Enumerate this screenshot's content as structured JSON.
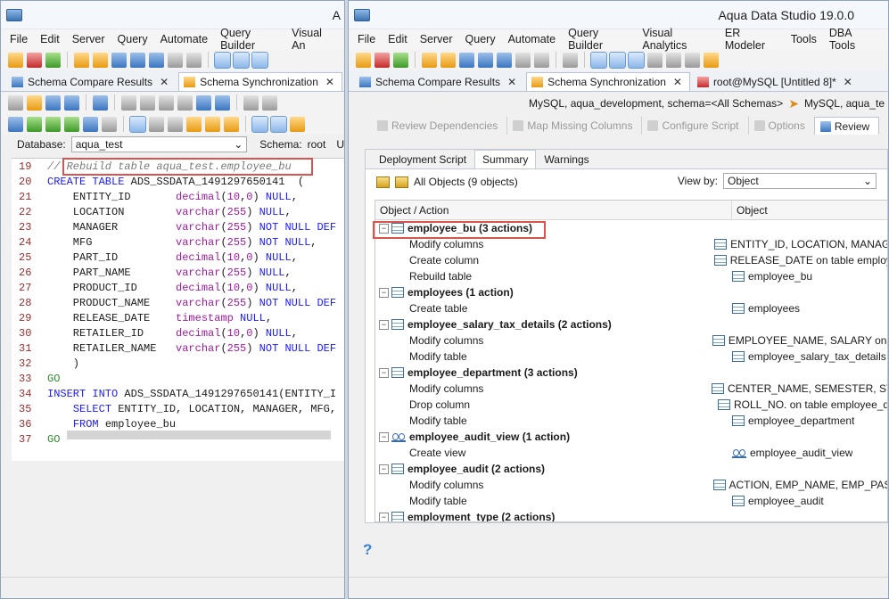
{
  "left": {
    "menu": [
      "File",
      "Edit",
      "Server",
      "Query",
      "Automate",
      "Query Builder",
      "Visual An"
    ],
    "title_fragment": "A",
    "tabs": [
      {
        "label": "Schema Compare Results"
      },
      {
        "label": "Schema Synchronization"
      }
    ],
    "database_label": "Database:",
    "database_value": "aqua_test",
    "schema_label": "Schema:",
    "schema_value": "root",
    "schema_extra": "U",
    "code_lines": [
      {
        "n": "19",
        "text": "// Rebuild table aqua_test.employee_bu",
        "kind": "comment"
      },
      {
        "n": "20",
        "text": "CREATE TABLE ADS_SSDATA_1491297650141  (",
        "kind": "create"
      },
      {
        "n": "21",
        "text": "    ENTITY_ID       decimal(10,0) NULL,",
        "kind": "col"
      },
      {
        "n": "22",
        "text": "    LOCATION        varchar(255) NULL,",
        "kind": "col"
      },
      {
        "n": "23",
        "text": "    MANAGER         varchar(255) NOT NULL DEF",
        "kind": "col"
      },
      {
        "n": "24",
        "text": "    MFG             varchar(255) NOT NULL,",
        "kind": "col"
      },
      {
        "n": "25",
        "text": "    PART_ID         decimal(10,0) NULL,",
        "kind": "col"
      },
      {
        "n": "26",
        "text": "    PART_NAME       varchar(255) NULL,",
        "kind": "col"
      },
      {
        "n": "27",
        "text": "    PRODUCT_ID      decimal(10,0) NULL,",
        "kind": "col"
      },
      {
        "n": "28",
        "text": "    PRODUCT_NAME    varchar(255) NOT NULL DEF",
        "kind": "col"
      },
      {
        "n": "29",
        "text": "    RELEASE_DATE    timestamp NULL,",
        "kind": "col"
      },
      {
        "n": "30",
        "text": "    RETAILER_ID     decimal(10,0) NULL,",
        "kind": "col"
      },
      {
        "n": "31",
        "text": "    RETAILER_NAME   varchar(255) NOT NULL DEF",
        "kind": "col"
      },
      {
        "n": "32",
        "text": "    )",
        "kind": "plain"
      },
      {
        "n": "33",
        "text": "GO",
        "kind": "go"
      },
      {
        "n": "34",
        "text": "INSERT INTO ADS_SSDATA_1491297650141(ENTITY_I",
        "kind": "insert"
      },
      {
        "n": "35",
        "text": "    SELECT ENTITY_ID, LOCATION, MANAGER, MFG,",
        "kind": "select"
      },
      {
        "n": "36",
        "text": "    FROM employee_bu",
        "kind": "from"
      },
      {
        "n": "37",
        "text": "GO",
        "kind": "go"
      }
    ]
  },
  "right": {
    "title": "Aqua Data Studio 19.0.0",
    "menu": [
      "File",
      "Edit",
      "Server",
      "Query",
      "Automate",
      "Query Builder",
      "Visual Analytics",
      "ER Modeler",
      "Tools",
      "DBA Tools"
    ],
    "tabs": [
      {
        "label": "Schema Compare Results"
      },
      {
        "label": "Schema Synchronization"
      },
      {
        "label": "root@MySQL [Untitled 8]*"
      }
    ],
    "breadcrumb_source": "MySQL, aqua_development,  schema=<All Schemas>",
    "breadcrumb_target": "MySQL, aqua_te",
    "steps": [
      "Review Dependencies",
      "Map Missing Columns",
      "Configure Script",
      "Options",
      "Review"
    ],
    "inner_tabs": [
      "Deployment Script",
      "Summary",
      "Warnings"
    ],
    "all_objects": "All Objects (9 objects)",
    "view_by_label": "View by:",
    "view_by_value": "Object",
    "col_action": "Object / Action",
    "col_object": "Object",
    "groups": [
      {
        "name": "employee_bu (3 actions)",
        "icon": "table",
        "children": [
          {
            "action": "Modify columns",
            "object": "ENTITY_ID, LOCATION, MANAGE",
            "icon": "table"
          },
          {
            "action": "Create column",
            "object": "RELEASE_DATE on table employe",
            "icon": "table"
          },
          {
            "action": "Rebuild table",
            "object": "employee_bu",
            "icon": "table"
          }
        ]
      },
      {
        "name": "employees (1 action)",
        "icon": "table",
        "children": [
          {
            "action": "Create table",
            "object": "employees",
            "icon": "table"
          }
        ]
      },
      {
        "name": "employee_salary_tax_details (2 actions)",
        "icon": "table",
        "children": [
          {
            "action": "Modify columns",
            "object": "EMPLOYEE_NAME, SALARY on ta",
            "icon": "table"
          },
          {
            "action": "Modify table",
            "object": "employee_salary_tax_details",
            "icon": "table"
          }
        ]
      },
      {
        "name": "employee_department (3 actions)",
        "icon": "table",
        "children": [
          {
            "action": "Modify columns",
            "object": "CENTER_NAME, SEMESTER, STA",
            "icon": "table"
          },
          {
            "action": "Drop column",
            "object": "ROLL_NO. on table employee_de",
            "icon": "table"
          },
          {
            "action": "Modify table",
            "object": "employee_department",
            "icon": "table"
          }
        ]
      },
      {
        "name": "employee_audit_view (1 action)",
        "icon": "view",
        "children": [
          {
            "action": "Create view",
            "object": "employee_audit_view",
            "icon": "view"
          }
        ]
      },
      {
        "name": "employee_audit (2 actions)",
        "icon": "table",
        "children": [
          {
            "action": "Modify columns",
            "object": "ACTION, EMP_NAME, EMP_PASS",
            "icon": "table"
          },
          {
            "action": "Modify table",
            "object": "employee_audit",
            "icon": "table"
          }
        ]
      },
      {
        "name": "employment_type (2 actions)",
        "icon": "table",
        "children": []
      }
    ],
    "help": "?"
  }
}
